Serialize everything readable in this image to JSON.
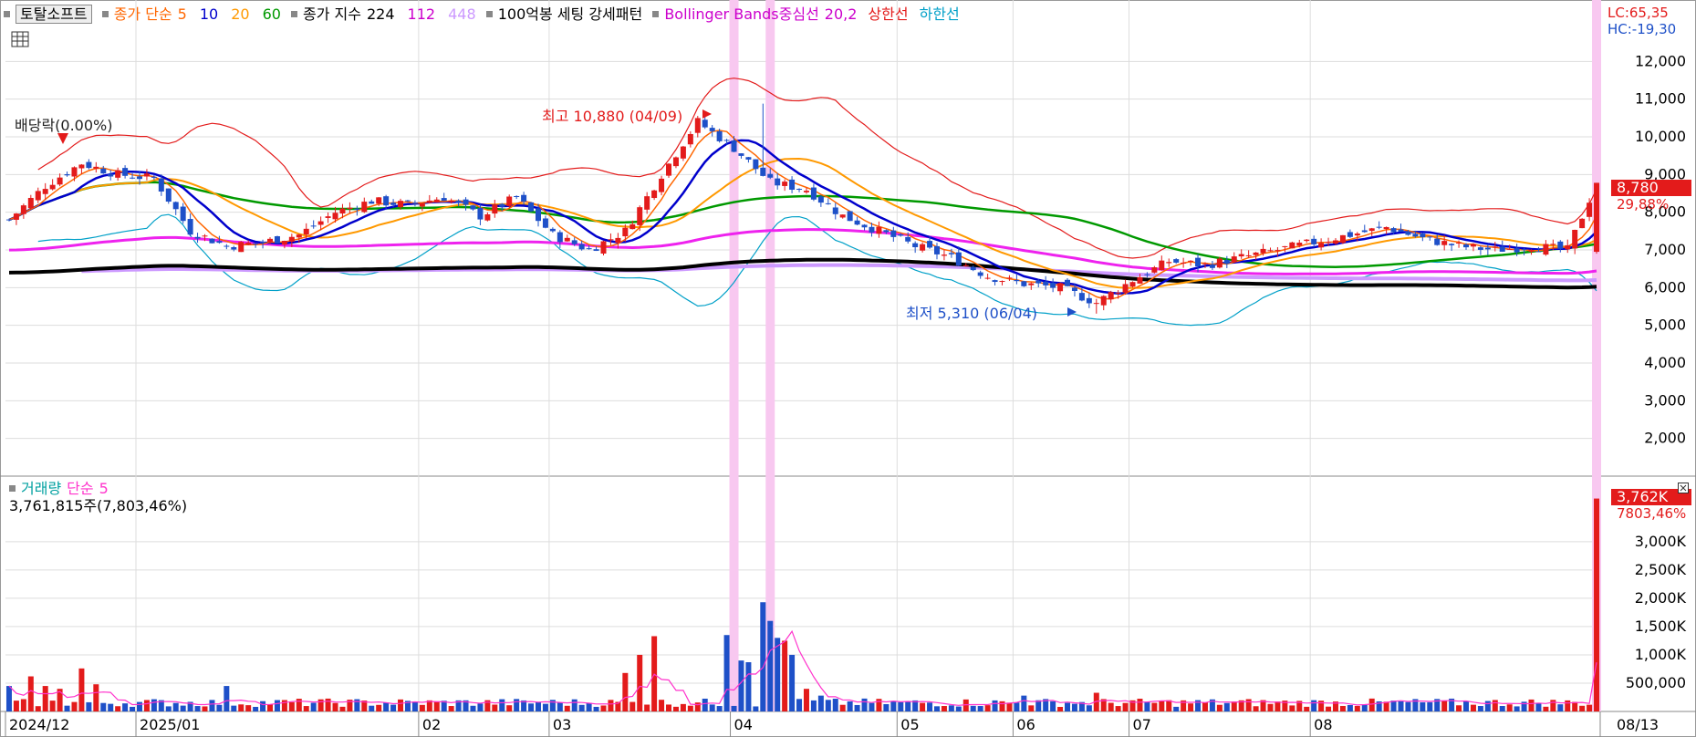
{
  "header": {
    "title": "토탈소프트",
    "ma_label": "종가 단순",
    "ma_periods": [
      "5",
      "10",
      "20",
      "60"
    ],
    "ma_colors": [
      "#ff6600",
      "#0000cc",
      "#ff9900",
      "#009900"
    ],
    "idx_label": "종가 지수",
    "idx_periods": [
      "224",
      "112",
      "448"
    ],
    "idx_colors": [
      "#000000",
      "#cc00cc",
      "#cc99ff"
    ],
    "pattern_label": "100억봉 세팅 강세패턴",
    "bb_label": "Bollinger Bands중심선",
    "bb_params": "20,2",
    "bb_upper": "상한선",
    "bb_lower": "하한선",
    "lc": "LC:65,35",
    "hc": "HC:-19,30"
  },
  "volume_header": {
    "label": "거래량",
    "ma_label": "단순",
    "ma_period": "5",
    "value_text": "3,761,815주(7,803,46%)"
  },
  "annotations": {
    "dividend": "배당락(0.00%)",
    "high": "최고 10,880 (04/09)",
    "low": "최저 5,310 (06/04)"
  },
  "price_tag": {
    "value": "8,780",
    "change": "29,88%"
  },
  "volume_tag": {
    "value": "3,762K",
    "change": "7803,46%"
  },
  "colors": {
    "up": "#e31b1b",
    "down": "#1e50c8",
    "highlight": "#f8c8f0"
  },
  "chart_data": {
    "type": "candlestick",
    "price_axis": {
      "ticks": [
        "12,000",
        "11,000",
        "10,000",
        "9,000",
        "8,000",
        "7,000",
        "6,000",
        "5,000",
        "4,000",
        "3,000",
        "2,000"
      ],
      "ylim": [
        1000,
        13000
      ]
    },
    "volume_axis": {
      "ticks": [
        "3,000K",
        "2,500K",
        "2,000K",
        "1,500K",
        "1,000K",
        "500,000"
      ],
      "ylim": [
        0,
        3900000
      ]
    },
    "x_labels": [
      "2024/12",
      "2025/01",
      "02",
      "03",
      "04",
      "05",
      "06",
      "07",
      "08"
    ],
    "x_end_label": "08/13",
    "series": [
      {
        "name": "종가 단순 5"
      },
      {
        "name": "종가 단순 10"
      },
      {
        "name": "종가 단순 20"
      },
      {
        "name": "종가 단순 60"
      },
      {
        "name": "종가 지수 224"
      },
      {
        "name": "종가 지수 112"
      },
      {
        "name": "종가 지수 448"
      },
      {
        "name": "Bollinger Bands 상한선"
      },
      {
        "name": "Bollinger Bands 하한선"
      }
    ],
    "close_points": [
      [
        0,
        7800
      ],
      [
        5,
        8700
      ],
      [
        10,
        9300
      ],
      [
        15,
        9000
      ],
      [
        20,
        8900
      ],
      [
        25,
        7500
      ],
      [
        30,
        7100
      ],
      [
        35,
        7200
      ],
      [
        40,
        7400
      ],
      [
        45,
        8000
      ],
      [
        50,
        8300
      ],
      [
        55,
        8200
      ],
      [
        60,
        8400
      ],
      [
        65,
        7900
      ],
      [
        70,
        8400
      ],
      [
        75,
        7400
      ],
      [
        80,
        7000
      ],
      [
        85,
        7500
      ],
      [
        90,
        9000
      ],
      [
        95,
        10400
      ],
      [
        100,
        9700
      ],
      [
        105,
        8800
      ],
      [
        110,
        8600
      ],
      [
        115,
        7900
      ],
      [
        120,
        7500
      ],
      [
        125,
        7100
      ],
      [
        130,
        6800
      ],
      [
        135,
        6300
      ],
      [
        140,
        6100
      ],
      [
        145,
        6000
      ],
      [
        150,
        5600
      ],
      [
        155,
        6200
      ],
      [
        160,
        6700
      ],
      [
        165,
        6600
      ],
      [
        170,
        6800
      ],
      [
        175,
        7000
      ],
      [
        180,
        7200
      ],
      [
        185,
        7400
      ],
      [
        190,
        7600
      ],
      [
        195,
        7300
      ],
      [
        200,
        7100
      ],
      [
        205,
        7000
      ],
      [
        210,
        7100
      ],
      [
        215,
        7000
      ],
      [
        219,
        8780
      ]
    ],
    "max": {
      "value": 10880,
      "date": "04/09"
    },
    "min": {
      "value": 5310,
      "date": "06/04"
    },
    "last": {
      "date": "08/13",
      "close": 8780,
      "volume": 3761815
    }
  }
}
